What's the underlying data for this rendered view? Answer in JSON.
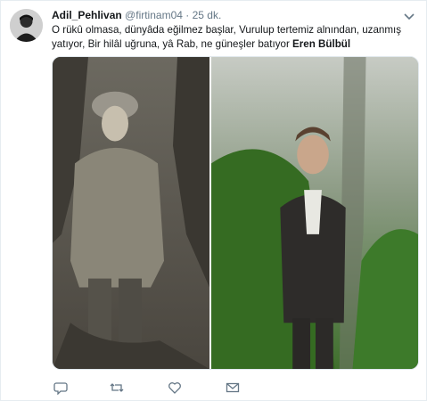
{
  "tweet": {
    "author_name": "Adil_Pehlivan",
    "handle": "@firtinam04",
    "separator": "·",
    "time": "25 dk.",
    "text_main": "O rükû olmasa, dünyâda eğilmez başlar, Vurulup tertemiz alnından, uzanmış yatıyor, Bir hilâl uğruna, yâ Rab, ne güneşler batıyor ",
    "text_author_tag": "Eren Bülbül"
  },
  "media": {
    "left_photo": "historical-soldier-photo",
    "right_photo": "young-man-forest-photo"
  },
  "actions": {
    "icons": [
      "reply-icon",
      "retweet-icon",
      "like-icon",
      "message-icon"
    ]
  },
  "colors": {
    "text": "#14171a",
    "secondary": "#657786",
    "border": "#e6ecf0"
  }
}
